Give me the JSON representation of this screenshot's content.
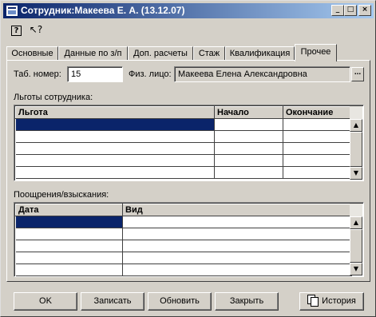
{
  "window": {
    "title": "Сотрудник:Макеева Е. А. (13.12.07)",
    "controls": {
      "minimize": "_",
      "maximize": "□",
      "close": "×"
    }
  },
  "toolbar": {
    "help": "?",
    "whats_this": "↖?"
  },
  "tabs": [
    {
      "label": "Основные"
    },
    {
      "label": "Данные по з/п"
    },
    {
      "label": "Доп. расчеты"
    },
    {
      "label": "Стаж"
    },
    {
      "label": "Квалификация"
    },
    {
      "label": "Прочее"
    }
  ],
  "active_tab": "Прочее",
  "form": {
    "tab_number_label": "Таб. номер:",
    "tab_number_value": "15",
    "person_label": "Физ. лицо:",
    "person_value": "Макеева Елена Александровна",
    "person_select": "..."
  },
  "benefits": {
    "section_label": "Льготы сотрудника:",
    "columns": [
      "Льгота",
      "Начало",
      "Окончание"
    ],
    "rows": [
      [
        "",
        "",
        ""
      ],
      [
        "",
        "",
        ""
      ],
      [
        "",
        "",
        ""
      ],
      [
        "",
        "",
        ""
      ],
      [
        "",
        "",
        ""
      ]
    ]
  },
  "rewards": {
    "section_label": "Поощрения/взыскания:",
    "columns": [
      "Дата",
      "Вид"
    ],
    "rows": [
      [
        "",
        ""
      ],
      [
        "",
        ""
      ],
      [
        "",
        ""
      ],
      [
        "",
        ""
      ],
      [
        "",
        ""
      ]
    ]
  },
  "scroll": {
    "up": "▲",
    "down": "▼"
  },
  "buttons": {
    "ok": "OK",
    "save": "Записать",
    "refresh": "Обновить",
    "close": "Закрыть",
    "history": "История"
  },
  "colors": {
    "face": "#d4d0c8",
    "selection": "#0a246a",
    "title_start": "#0a246a",
    "title_end": "#a6caf0"
  }
}
